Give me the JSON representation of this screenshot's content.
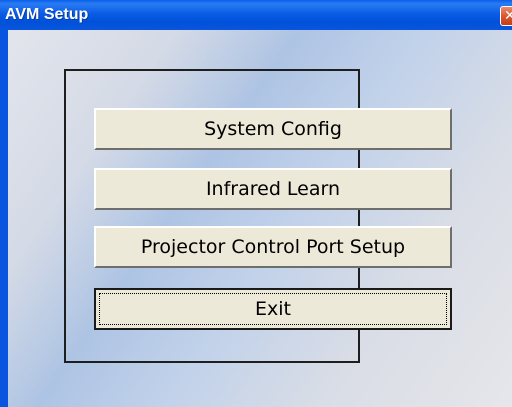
{
  "window": {
    "title": "AVM Setup",
    "close_glyph": "✕"
  },
  "menu": {
    "buttons": [
      {
        "label": "System Config"
      },
      {
        "label": "Infrared Learn"
      },
      {
        "label": "Projector Control Port Setup"
      },
      {
        "label": "Exit"
      }
    ]
  },
  "colors": {
    "titlebar": "#0054e3",
    "button_face": "#ece9d8",
    "close_button": "#d8552d"
  },
  "icons": {
    "close": "close-icon"
  }
}
